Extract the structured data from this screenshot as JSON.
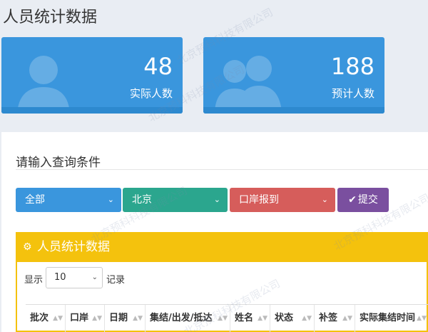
{
  "page": {
    "title": "人员统计数据"
  },
  "cards": [
    {
      "value": "48",
      "label": "实际人数",
      "icon": "user-icon"
    },
    {
      "value": "188",
      "label": "预计人数",
      "icon": "users-icon"
    }
  ],
  "query": {
    "title": "请输入查询条件",
    "selects": [
      {
        "value": "全部",
        "color": "#3a96dd"
      },
      {
        "value": "北京",
        "color": "#2ba68e"
      },
      {
        "value": "口岸报到",
        "color": "#d65d5b"
      }
    ],
    "submit_label": "提交"
  },
  "table_panel": {
    "title": "人员统计数据",
    "show_label": "显示",
    "page_length": "10",
    "records_label": "记录",
    "columns": [
      "批次",
      "口岸",
      "日期",
      "集结/出发/抵达",
      "姓名",
      "状态",
      "补签",
      "实际集结时间"
    ]
  },
  "colors": {
    "accent": "#3a96dd",
    "panel_header": "#f4c20d",
    "submit": "#7a4f9f"
  },
  "watermark": "北京预科科技有限公司"
}
